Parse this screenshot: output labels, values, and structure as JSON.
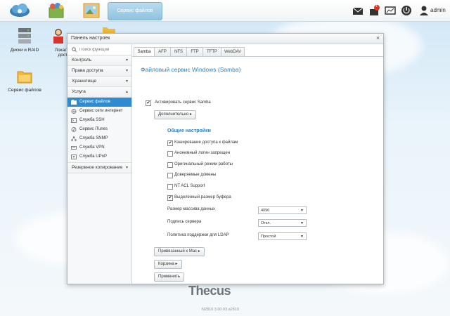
{
  "topbar": {
    "active_tab": "Сервис файлов",
    "user": "admin",
    "notification_badge": "1",
    "icons": [
      "envelope-icon",
      "notification-icon",
      "monitor-icon",
      "power-icon",
      "user-icon"
    ]
  },
  "desktop": {
    "icons": [
      {
        "label": "Диски и RAID",
        "icon": "disks-icon"
      },
      {
        "label": "Локальн доступ",
        "icon": "users-icon"
      },
      {
        "label": "Сервис файлов",
        "icon": "folder-icon"
      }
    ]
  },
  "window": {
    "title": "Панель настроек",
    "search_placeholder": "Поиск функций",
    "sections": [
      {
        "label": "Контроль"
      },
      {
        "label": "Права доступа"
      },
      {
        "label": "Хранилище"
      },
      {
        "label": "Услуга"
      }
    ],
    "service_items": [
      {
        "label": "Сервис файлов",
        "icon": "file-service-icon"
      },
      {
        "label": "Сервис сети интернет",
        "icon": "globe-icon"
      },
      {
        "label": "Служба SSH",
        "icon": "terminal-icon"
      },
      {
        "label": "Сервис iTunes",
        "icon": "music-icon"
      },
      {
        "label": "Служба SNMP",
        "icon": "network-icon"
      },
      {
        "label": "Служба VPN",
        "icon": "vpn-icon"
      },
      {
        "label": "Служба UPnP",
        "icon": "upnp-icon"
      }
    ],
    "backup_section": "Резервное копирование"
  },
  "tabs": [
    "Samba",
    "AFP",
    "NFS",
    "FTP",
    "TFTP",
    "WebDAV"
  ],
  "samba": {
    "title": "Файловый сервис Windows (Samba)",
    "enable_label": "Активировать сервис Samba",
    "advanced_button": "Дополнительно",
    "general_heading": "Общие настройки",
    "options": [
      {
        "label": "Кэширование доступа к файлам",
        "checked": true
      },
      {
        "label": "Анонимный логин запрещен",
        "checked": false
      },
      {
        "label": "Оригинальный режим работы",
        "checked": false
      },
      {
        "label": "Доверяемые домены",
        "checked": false
      },
      {
        "label": "NT ACL Support",
        "checked": false
      },
      {
        "label": "Выделенный размер буфера",
        "checked": true
      }
    ],
    "selects": [
      {
        "label": "Размер массива данных",
        "value": "4096"
      },
      {
        "label": "Подпись сервера",
        "value": "Откл."
      },
      {
        "label": "Политика поддержки для LDAP",
        "value": "Простой"
      }
    ],
    "mac_button": "Привязанный к Mac",
    "recycle_button": "Корзина",
    "apply_button": "Применить"
  },
  "footer": {
    "brand": "Thecus",
    "model": "N2810   3.00.03.a2810"
  },
  "colors": {
    "accent": "#2f8bd0",
    "title_blue": "#2c83c6"
  }
}
